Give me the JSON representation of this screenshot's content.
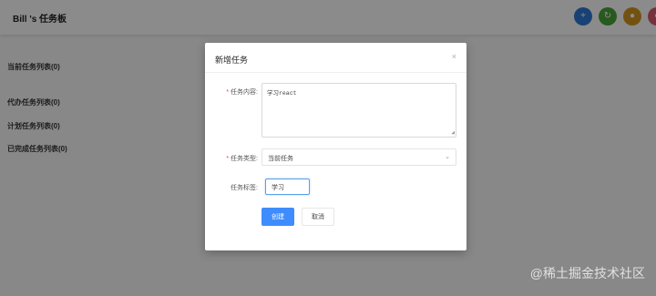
{
  "app": {
    "title": "Bill 's 任务板",
    "header_buttons": [
      {
        "icon": "plus-icon",
        "glyph": "+",
        "color": "#2f78d4"
      },
      {
        "icon": "refresh-icon",
        "glyph": "↻",
        "color": "#4aa33a"
      },
      {
        "icon": "user-icon",
        "glyph": "●",
        "color": "#d1961f"
      },
      {
        "icon": "settings-icon",
        "glyph": "●",
        "color": "#d65b6e"
      }
    ],
    "sections": [
      {
        "label": "当前任务列表(0)"
      },
      {
        "label": "代办任务列表(0)"
      },
      {
        "label": "计划任务列表(0)"
      },
      {
        "label": "已完成任务列表(0)"
      }
    ]
  },
  "modal": {
    "title": "新增任务",
    "close_glyph": "×",
    "fields": {
      "content": {
        "label": "任务内容:",
        "value": "学习react"
      },
      "type": {
        "label": "任务类型:",
        "value": "当前任务"
      },
      "tag": {
        "label": "任务标签:",
        "value": "学习"
      }
    },
    "buttons": {
      "create": "创建",
      "cancel": "取消"
    }
  },
  "watermark": "@稀土掘金技术社区",
  "colors": {
    "primary": "#3f8cff",
    "required": "#e0443c"
  }
}
